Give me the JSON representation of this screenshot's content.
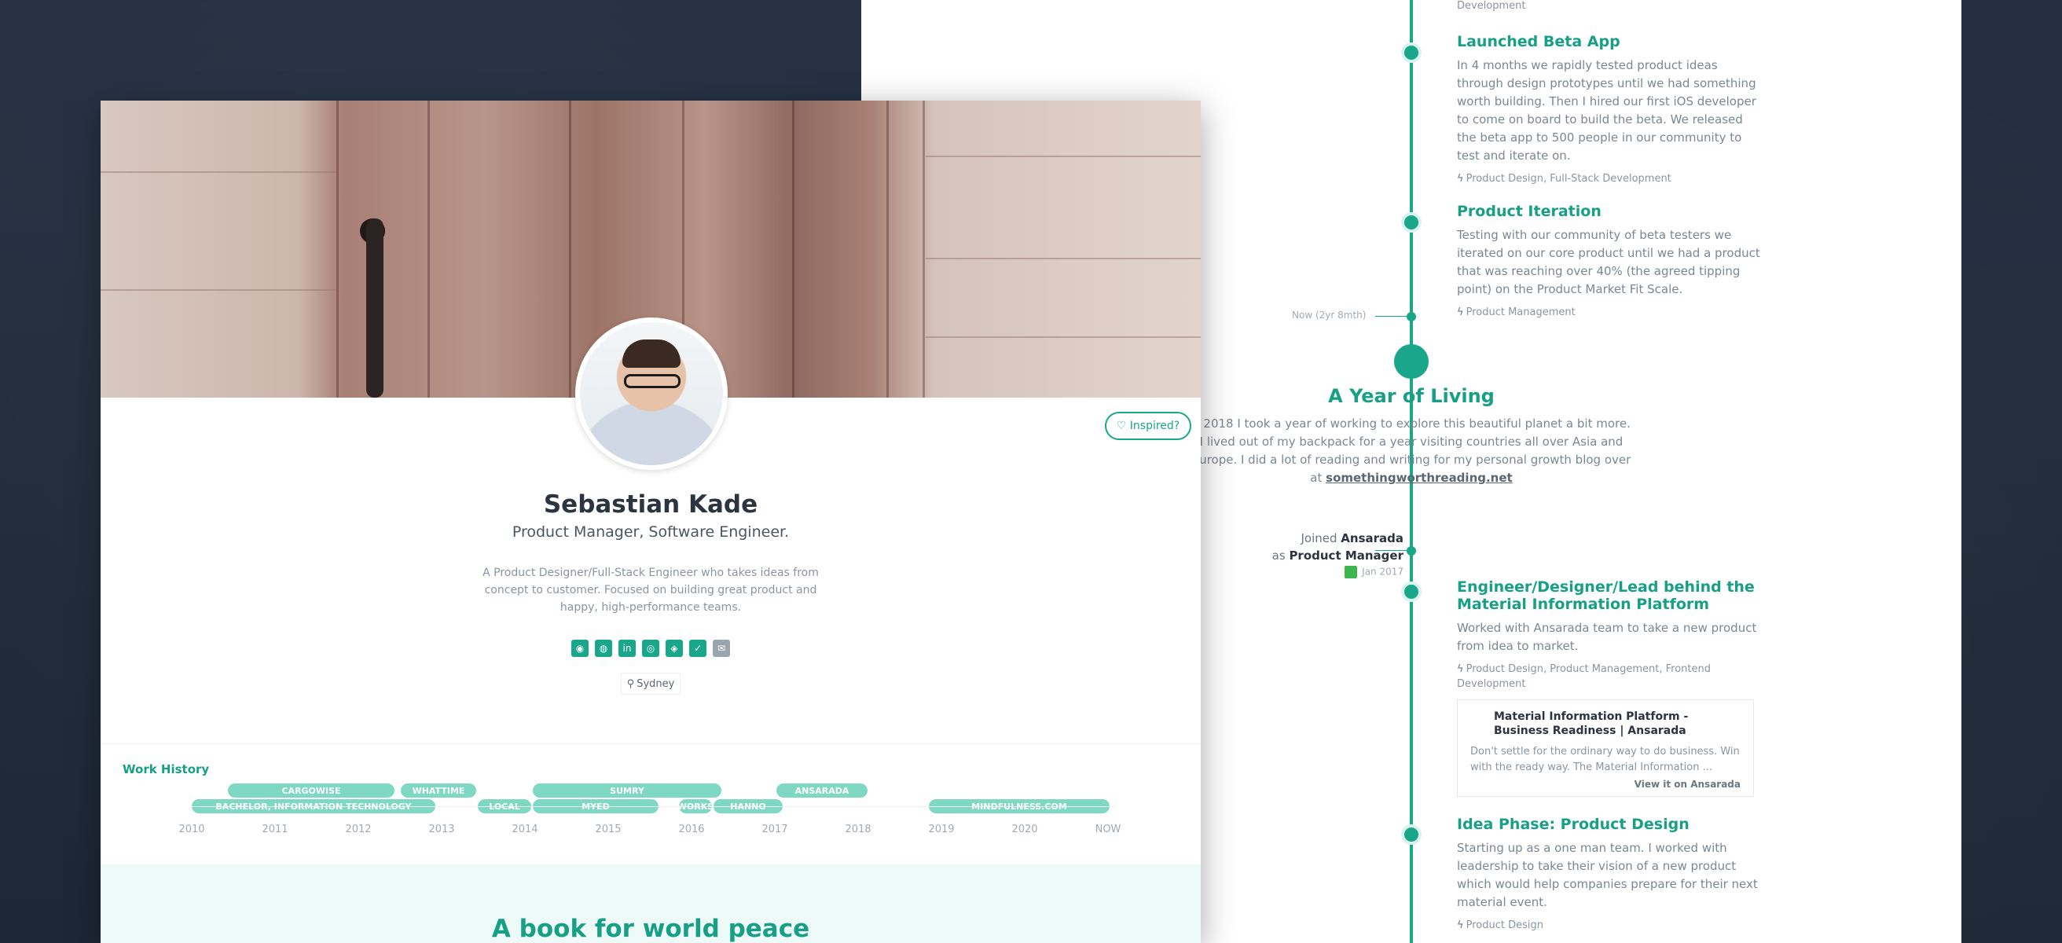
{
  "timeline": {
    "top_tags": "Development",
    "entries": [
      {
        "title": "Launched Beta App",
        "description": "In 4 months we rapidly tested product ideas through design prototypes until we had something worth building. Then I hired our first iOS developer to come on board to build the beta. We released the beta app to 500 people in our community to test and iterate on.",
        "tags": "Product Design, Full-Stack Development"
      },
      {
        "title": "Product Iteration",
        "description": "Testing with our community of beta testers we iterated on our core product until we had a product that was reaching over 40% (the agreed tipping point) on the Product Market Fit Scale.",
        "tags": "Product Management"
      },
      {
        "title": "Engineer/Designer/Lead behind the Material Information Platform",
        "description": "Worked with Ansarada team to take a new product from idea to market.",
        "tags": "Product Design, Product Management, Frontend Development"
      },
      {
        "title": "Idea Phase: Product Design",
        "description": "Starting up as a one man team. I worked with leadership to take their vision of a new product which would help companies prepare for their next material event.",
        "tags": "Product Design"
      }
    ],
    "now_label": "Now (2yr 8mth)",
    "year_of_living": {
      "title": "A Year of Living",
      "description_1": "n 2018 I took a year of working to explore this beautiful planet a bit more. I lived out of my backpack for a year visiting countries all over Asia and Europe. I did a lot of reading and writing for my personal growth blog over at",
      "link": "somethingworthreading.net"
    },
    "joined": {
      "prefix": "Joined",
      "company": "Ansarada",
      "as_text": "as",
      "position": "Product Manager",
      "date": "Jan 2017"
    },
    "link_card": {
      "title": "Material Information Platform - Business Readiness | Ansarada",
      "description": "Don't settle for the ordinary way to do business. Win with the ready way. The Material Information ...",
      "link_label": "View it on Ansarada"
    }
  },
  "profile": {
    "inspired_label": "♡ Inspired?",
    "name": "Sebastian Kade",
    "role": "Product Manager, Software Engineer.",
    "bio": "A Product Designer/Full-Stack Engineer who takes ideas from concept to customer. Focused on building great product and happy, high-performance teams.",
    "socials": [
      {
        "icon": "globe-icon",
        "glyph": "◉"
      },
      {
        "icon": "dribbble-icon",
        "glyph": "◍"
      },
      {
        "icon": "linkedin-icon",
        "glyph": "in"
      },
      {
        "icon": "github-icon",
        "glyph": "◎"
      },
      {
        "icon": "stackoverflow-icon",
        "glyph": "◈"
      },
      {
        "icon": "twitter-icon",
        "glyph": "✓"
      },
      {
        "icon": "email-icon",
        "glyph": "✉"
      }
    ],
    "location_icon": "map-pin-icon",
    "location": "Sydney"
  },
  "work_history": {
    "title": "Work History",
    "bars": [
      {
        "label": "CARGOWISE"
      },
      {
        "label": "WHATTIME"
      },
      {
        "label": "SUMRY"
      },
      {
        "label": "ANSARADA"
      },
      {
        "label": "BACHELOR, INFORMATION TECHNOLOGY"
      },
      {
        "label": "LOCAL"
      },
      {
        "label": "MYED"
      },
      {
        "label": "WORKS"
      },
      {
        "label": "HANNO"
      },
      {
        "label": "MINDFULNESS.COM"
      }
    ],
    "years": [
      "2010",
      "2011",
      "2012",
      "2013",
      "2014",
      "2015",
      "2016",
      "2017",
      "2018",
      "2019",
      "2020",
      "NOW"
    ]
  },
  "book": {
    "title": "A book for world peace"
  },
  "colors": {
    "accent": "#1aa68a",
    "bar": "#7fd8c4",
    "background": "#1f2937"
  }
}
